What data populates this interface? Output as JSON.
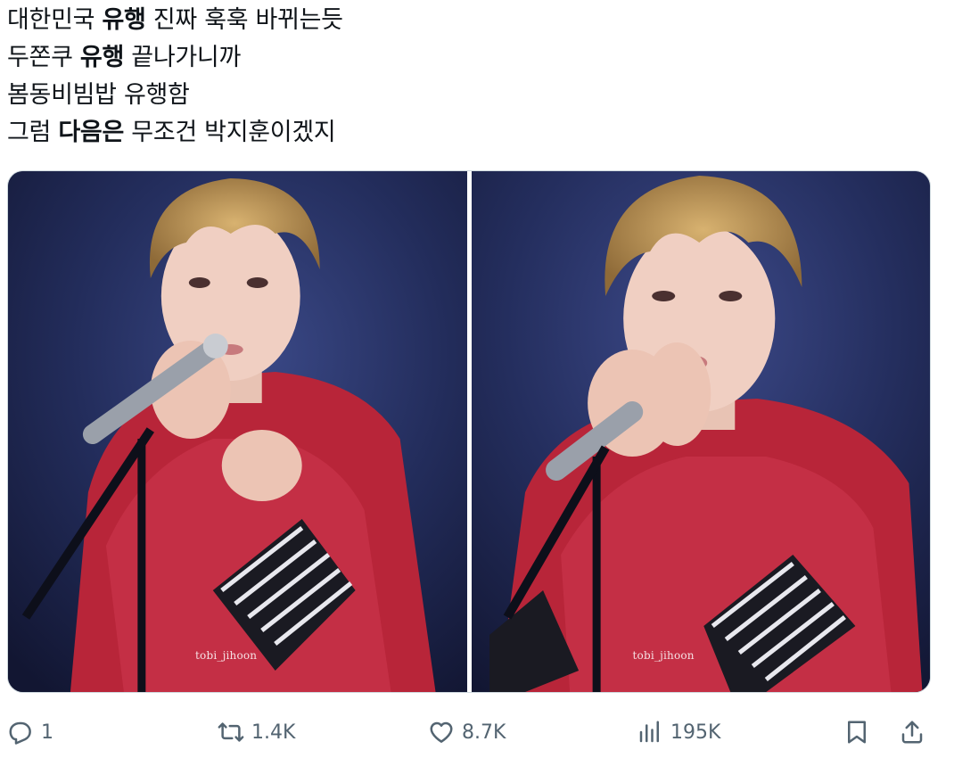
{
  "post": {
    "lines": [
      {
        "before": "대한민국 ",
        "bold": "유행",
        "after": " 진짜 훅훅 바뀌는듯"
      },
      {
        "before": "두쫀쿠 ",
        "bold": "유행",
        "after": " 끝나가니까"
      },
      {
        "before": "봄동비빔밥 유행함",
        "bold": "",
        "after": ""
      },
      {
        "before": "그럼 ",
        "bold": "다음은",
        "after": " 무조건 박지훈이겠지"
      }
    ]
  },
  "media": {
    "photos": [
      {
        "watermark": "tobi_jihoon",
        "icon": "concert-singer-photo"
      },
      {
        "watermark": "tobi_jihoon",
        "icon": "concert-singer-photo"
      }
    ]
  },
  "actions": {
    "reply": {
      "count": "1",
      "icon": "reply-icon"
    },
    "repost": {
      "count": "1.4K",
      "icon": "repost-icon"
    },
    "like": {
      "count": "8.7K",
      "icon": "heart-icon"
    },
    "views": {
      "count": "195K",
      "icon": "views-icon"
    },
    "bookmark": {
      "icon": "bookmark-icon"
    },
    "share": {
      "icon": "share-icon"
    }
  },
  "colors": {
    "text": "#0f1419",
    "muted": "#536471",
    "border": "#cfd9de",
    "stage_bg": "#222c58",
    "shirt": "#c0283c"
  }
}
